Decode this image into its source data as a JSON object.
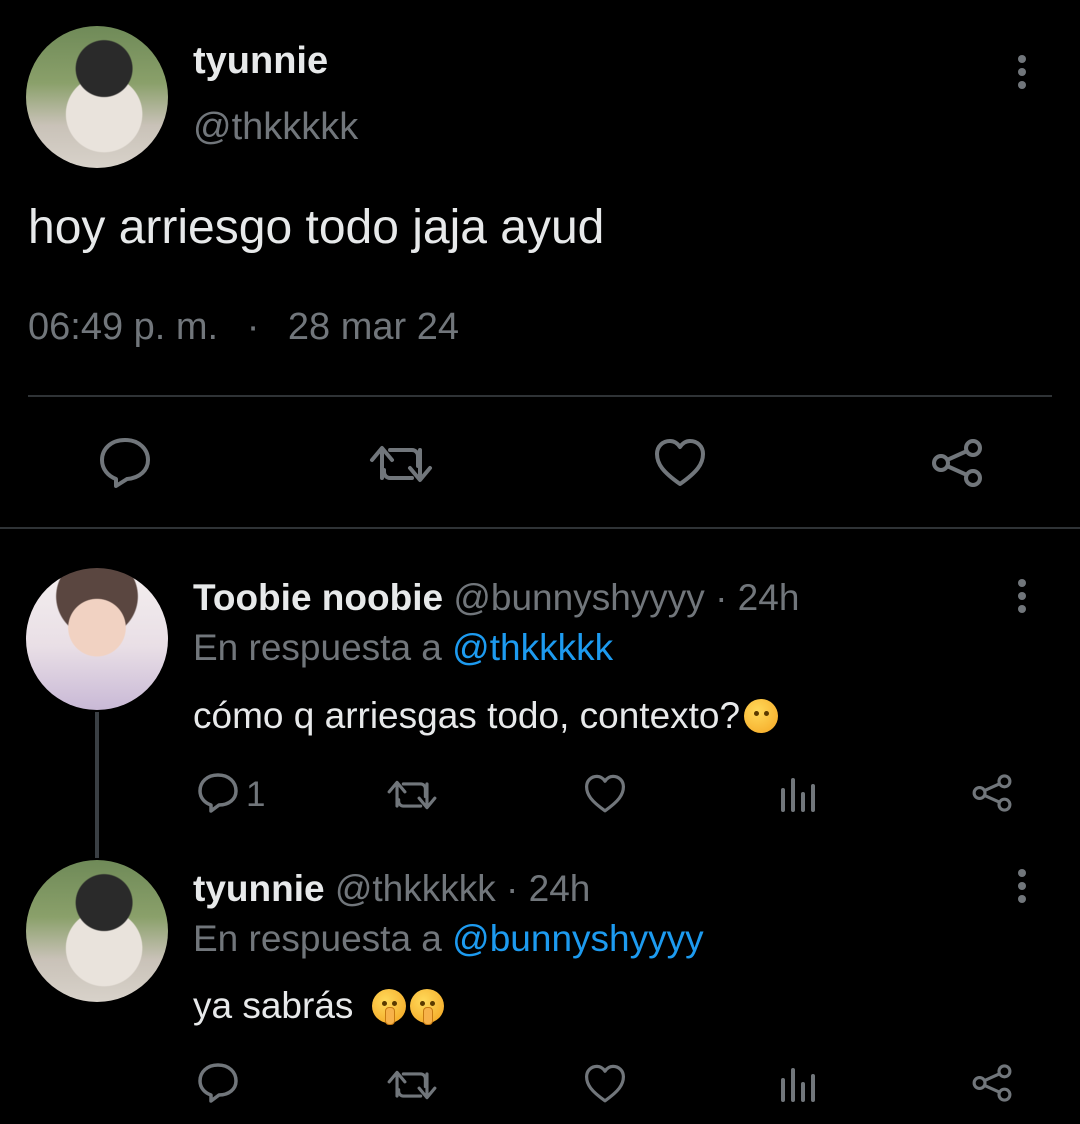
{
  "main_tweet": {
    "display_name": "tyunnie",
    "handle": "@thkkkkk",
    "text": "hoy arriesgo todo jaja ayud",
    "time": "06:49 p. m.",
    "separator": "·",
    "date": "28 mar 24",
    "actions": [
      "reply-icon",
      "retweet-icon",
      "like-icon",
      "share-icon"
    ]
  },
  "replies": [
    {
      "display_name": "Toobie noobie",
      "handle": "@bunnyshyyyy",
      "age": "· 24h",
      "reply_prefix": "En respuesta a",
      "reply_to": "@thkkkkk",
      "text": "cómo q arriesgas todo, contexto?",
      "reply_count": "1"
    },
    {
      "display_name": "tyunnie",
      "handle": "@thkkkkk",
      "age": "· 24h",
      "reply_prefix": "En respuesta a",
      "reply_to": "@bunnyshyyyy",
      "text": "ya sabrás",
      "reply_count": ""
    }
  ],
  "colors": {
    "background": "#000000",
    "text": "#e7e9ea",
    "muted": "#71767b",
    "link": "#1d9bf0",
    "divider": "#2f3336"
  }
}
